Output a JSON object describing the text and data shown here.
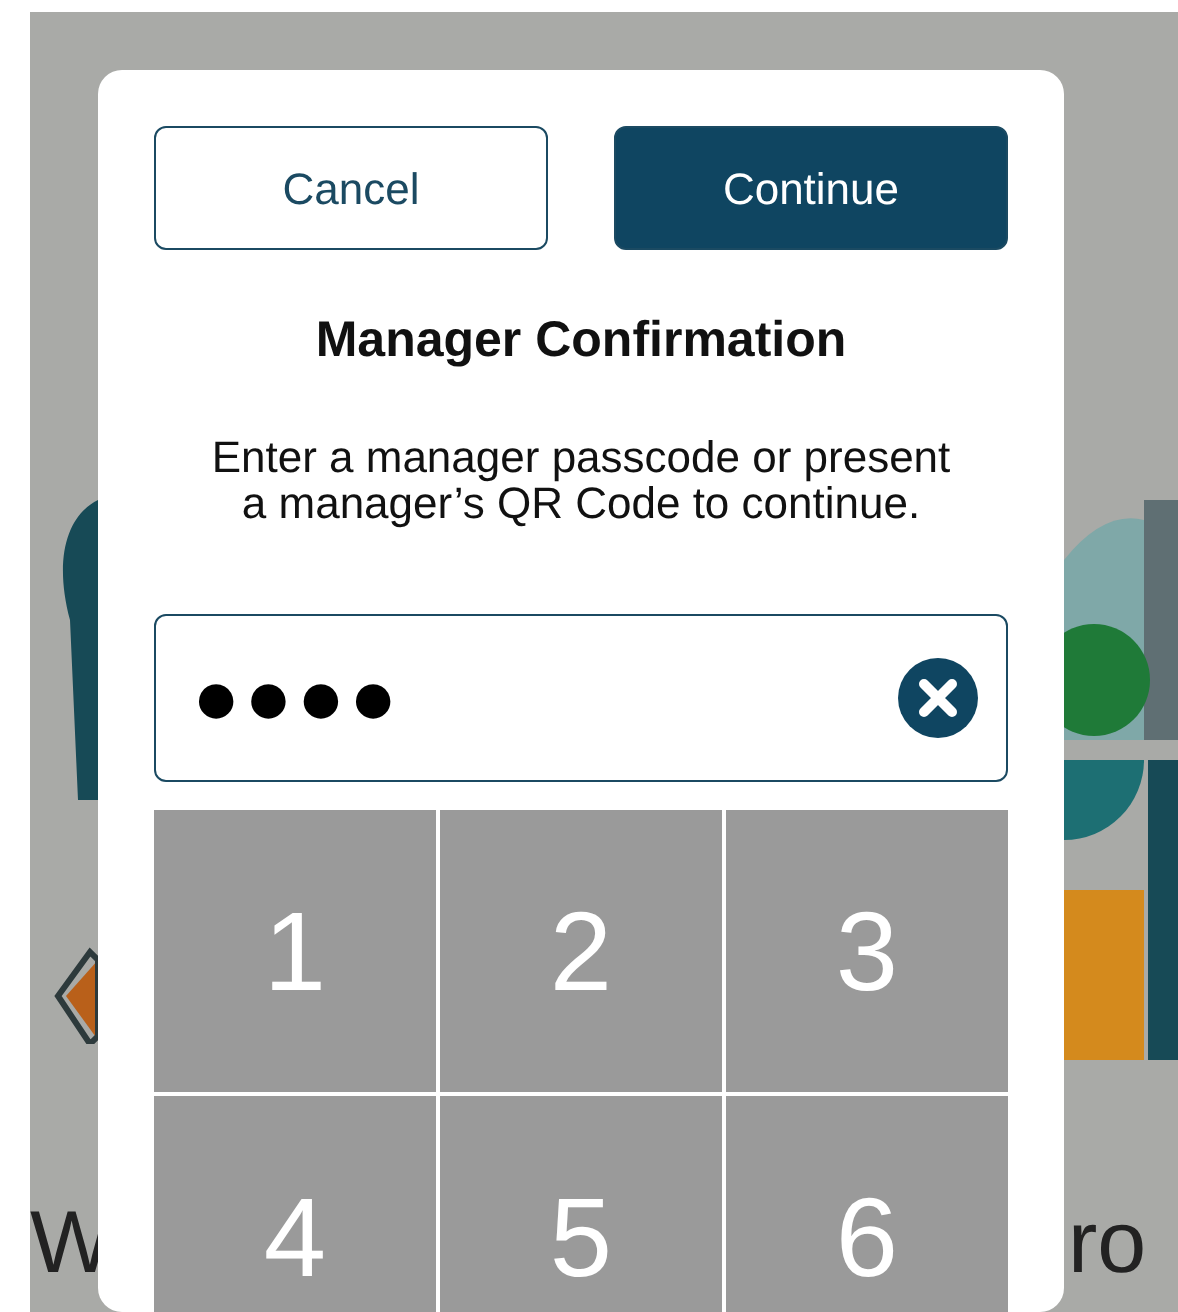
{
  "background": {
    "text_left": "W",
    "text_right": "ro"
  },
  "dialog": {
    "buttons": [
      {
        "label": "Cancel",
        "kind": "secondary"
      },
      {
        "label": "Continue",
        "kind": "primary"
      }
    ],
    "title": "Manager Confirmation",
    "message": "Enter a manager passcode or present a manager’s QR Code to continue.",
    "passcode_field": {
      "value": "●●●●"
    },
    "keypad": [
      "1",
      "2",
      "3",
      "4",
      "5",
      "6"
    ]
  }
}
